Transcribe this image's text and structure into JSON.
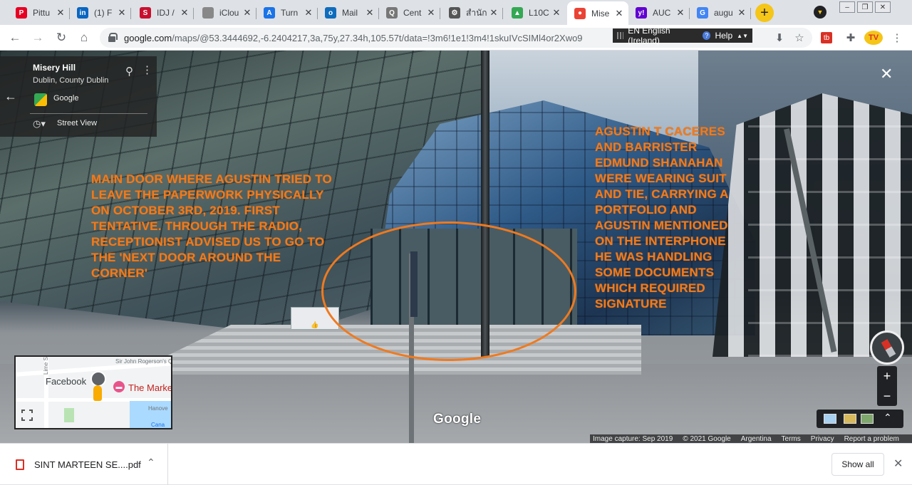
{
  "tabs": [
    {
      "title": "Pittu",
      "icon": "pinterest-icon",
      "color": "#e60023",
      "glyph": "P"
    },
    {
      "title": "(1) F",
      "icon": "linkedin-icon",
      "color": "#0a66c2",
      "glyph": "in"
    },
    {
      "title": "IDJ /",
      "icon": "s-icon",
      "color": "#c8102e",
      "glyph": "S"
    },
    {
      "title": "iClou",
      "icon": "apple-icon",
      "color": "#888888",
      "glyph": ""
    },
    {
      "title": "Turn",
      "icon": "translate-icon",
      "color": "#1a73e8",
      "glyph": "A"
    },
    {
      "title": "Mail",
      "icon": "outlook-icon",
      "color": "#0f6cbd",
      "glyph": "o"
    },
    {
      "title": "Cent",
      "icon": "search-glass-icon",
      "color": "#777777",
      "glyph": "Q"
    },
    {
      "title": "สำนัก",
      "icon": "gear-icon",
      "color": "#555555",
      "glyph": "⚙"
    },
    {
      "title": "L10C",
      "icon": "drive-icon",
      "color": "#34a853",
      "glyph": "▲"
    },
    {
      "title": "Mise",
      "icon": "maps-icon",
      "color": "#ea4335",
      "glyph": "●"
    },
    {
      "title": "AUC",
      "icon": "yahoo-icon",
      "color": "#6001d2",
      "glyph": "y!"
    },
    {
      "title": "augu",
      "icon": "google-icon",
      "color": "#4285f4",
      "glyph": "G"
    }
  ],
  "url": {
    "host": "google.com",
    "path": "/maps/@53.3444692,-6.2404217,3a,75y,27.34h,105.57t/data=!3m6!1e1!3m4!1skuIVcSIMl4or2Xwo9"
  },
  "translator": {
    "language": "EN English (Ireland)",
    "help": "Help"
  },
  "infocard": {
    "title": "Misery Hill",
    "subtitle": "Dublin, County Dublin",
    "provider": "Google",
    "mode": "Street View"
  },
  "annotations": {
    "left": "MAIN DOOR WHERE AGUSTIN TRIED TO LEAVE THE PAPERWORK PHYSICALLY ON OCTOBER 3RD, 2019. FIRST TENTATIVE. THROUGH THE RADIO, RECEPTIONIST ADVISED US TO GO TO THE 'NEXT DOOR AROUND THE CORNER'",
    "right": "AGUSTIN T CACERES AND BARRISTER EDMUND SHANAHAN WERE WEARING SUIT AND TIE, CARRYING A PORTFOLIO AND AGUSTIN MENTIONED ON THE INTERPHONE HE WAS HANDLING SOME DOCUMENTS WHICH REQUIRED SIGNATURE"
  },
  "minimap": {
    "place1": "Facebook",
    "place2": "The Marke",
    "street1": "Sir John Rogerson's Qua",
    "street2": "Lime S",
    "street3": "Hanove",
    "water": "Cana"
  },
  "logo": "Google",
  "footer": {
    "capture": "Image capture: Sep 2019",
    "copyright": "© 2021 Google",
    "country": "Argentina",
    "terms": "Terms",
    "privacy": "Privacy",
    "report": "Report a problem"
  },
  "download": {
    "filename": "SINT MARTEEN SE....pdf",
    "show_all": "Show all"
  },
  "colors": {
    "annotation": "#f07b1c",
    "accent": "#1a73e8"
  }
}
